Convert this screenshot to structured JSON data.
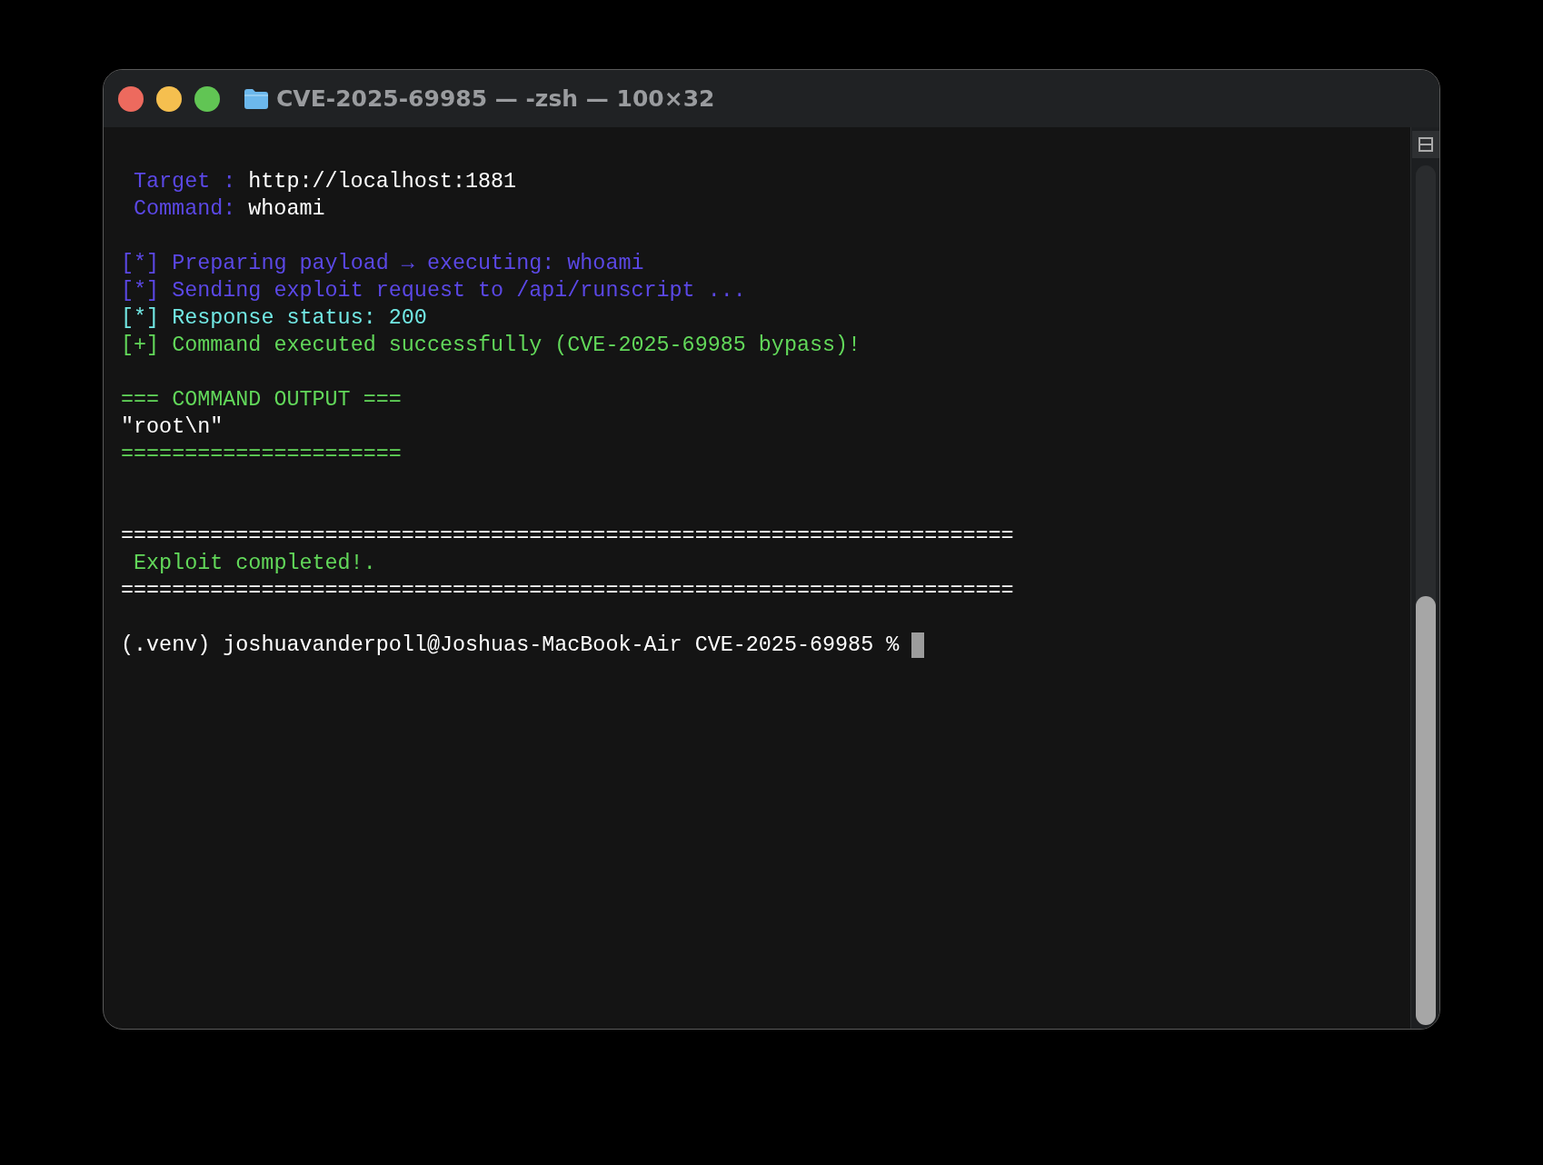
{
  "window": {
    "title": "CVE-2025-69985 — -zsh — 100×32"
  },
  "lines": [
    {
      "kind": "blank"
    },
    {
      "kind": "text",
      "indent": true,
      "segments": [
        {
          "text": "Target :",
          "color": "#5b48e6"
        },
        {
          "text": "http://localhost:1881",
          "color": "#ffffff"
        }
      ]
    },
    {
      "kind": "text",
      "indent": true,
      "segments": [
        {
          "text": "Command:",
          "color": "#5b48e6"
        },
        {
          "text": "whoami",
          "color": "#ffffff"
        }
      ]
    },
    {
      "kind": "blank"
    },
    {
      "kind": "text",
      "indent": false,
      "segments": [
        {
          "text": "[*] Preparing payload → executing: whoami",
          "color": "#5b48e6"
        }
      ]
    },
    {
      "kind": "text",
      "indent": false,
      "segments": [
        {
          "text": "[*] Sending exploit request to /api/runscript ...",
          "color": "#5b48e6"
        }
      ]
    },
    {
      "kind": "text",
      "indent": false,
      "segments": [
        {
          "text": "[*] Response status: 200",
          "color": "#72e8e4"
        }
      ]
    },
    {
      "kind": "text",
      "indent": false,
      "segments": [
        {
          "text": "[+] Command executed successfully (CVE-2025-69985 bypass)!",
          "color": "#62d85a"
        }
      ]
    },
    {
      "kind": "blank"
    },
    {
      "kind": "text",
      "indent": false,
      "segments": [
        {
          "text": "=== COMMAND OUTPUT ===",
          "color": "#62d85a"
        }
      ]
    },
    {
      "kind": "text",
      "indent": false,
      "segments": [
        {
          "text": "\"root\\n\"",
          "color": "#ffffff"
        }
      ]
    },
    {
      "kind": "text",
      "indent": false,
      "segments": [
        {
          "text": "======================",
          "color": "#62d85a"
        }
      ]
    },
    {
      "kind": "blank"
    },
    {
      "kind": "blank"
    },
    {
      "kind": "text",
      "indent": false,
      "segments": [
        {
          "text": "======================================================================",
          "color": "#ffffff"
        }
      ]
    },
    {
      "kind": "text",
      "indent": true,
      "segments": [
        {
          "text": "Exploit completed!.",
          "color": "#62d85a"
        }
      ]
    },
    {
      "kind": "text",
      "indent": false,
      "segments": [
        {
          "text": "======================================================================",
          "color": "#ffffff"
        }
      ]
    },
    {
      "kind": "blank"
    },
    {
      "kind": "prompt",
      "indent": false,
      "segments": [
        {
          "text": "(.venv) joshuavanderpoll@Joshuas-MacBook-Air CVE-2025-69985 %",
          "color": "#ffffff"
        }
      ]
    }
  ]
}
